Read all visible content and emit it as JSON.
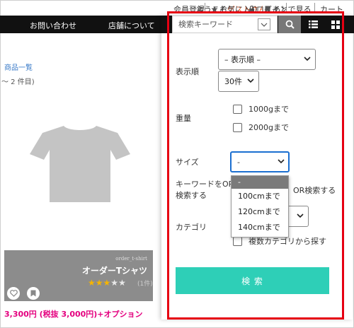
{
  "topbar": {
    "welcome_prefix": "ようこそ",
    "guest_name": "ゲストさん",
    "login": "ログイン",
    "register": "会員登録",
    "favorites": "お気に入り",
    "later": "あとで見る",
    "cart": "カート"
  },
  "nav": {
    "contact": "お問い合わせ",
    "about": "店舗について"
  },
  "page": {
    "breadcrumb": "商品一覧",
    "result_count": "〜 2 件目)"
  },
  "product": {
    "tag": "order_t-shirt",
    "name": "オーダーTシャツ",
    "rating": 3,
    "rating_max": 5,
    "reviews": "(1件)",
    "price": "3,300円 (税抜 3,000円)+オプション"
  },
  "search": {
    "keyword_placeholder": "検索キーワード",
    "sort_label": "表示順",
    "sort_value": "– 表示順 –",
    "per_page_value": "30件",
    "weight_label": "重量",
    "weight_options": [
      "1000gまで",
      "2000gまで"
    ],
    "size_label": "サイズ",
    "size_value": "-",
    "size_options": [
      "-",
      "100cmまで",
      "120cmまで",
      "140cmまで"
    ],
    "keyword_or_label_1": "キーワードをOR",
    "keyword_or_label_2": "検索する",
    "keyword_or_option": "OR検索する",
    "category_label": "カテゴリ",
    "multi_category_option": "複数カテゴリから探す",
    "submit_label": "検 索"
  },
  "colors": {
    "accent": "#2ecfb7",
    "highlight": "#e60012",
    "price": "#e4007f",
    "guest": "#e45d2d"
  }
}
